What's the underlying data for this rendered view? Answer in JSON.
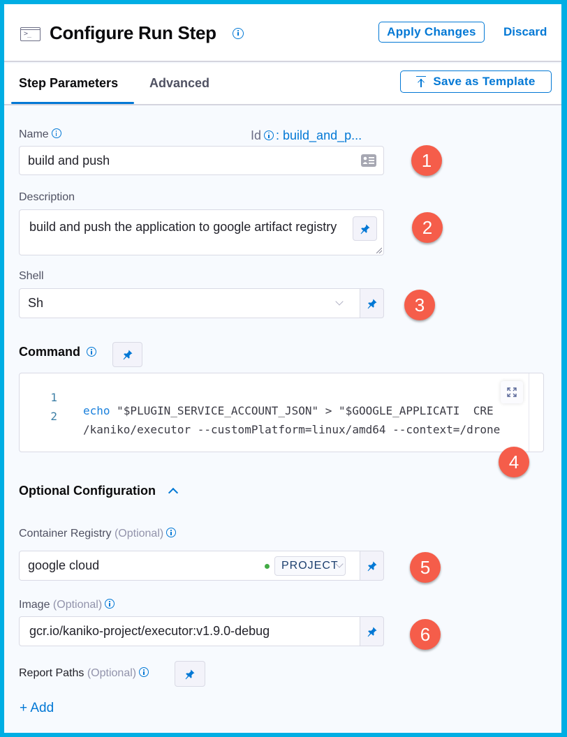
{
  "header": {
    "title": "Configure Run Step",
    "apply_label": "Apply Changes",
    "discard_label": "Discard",
    "terminal_glyph": ">_"
  },
  "tabs": {
    "items": [
      {
        "label": "Step Parameters",
        "active": true
      },
      {
        "label": "Advanced",
        "active": false
      }
    ],
    "save_template_label": "Save as Template"
  },
  "form": {
    "name": {
      "label": "Name",
      "value": "build and push",
      "id_label": "Id",
      "id_value": ": build_and_p..."
    },
    "description": {
      "label": "Description",
      "value": "build and push the application to google artifact registry"
    },
    "shell": {
      "label": "Shell",
      "value": "Sh"
    },
    "command": {
      "label": "Command",
      "lines": [
        {
          "num": "1",
          "keyword": "echo",
          "text": " \"$PLUGIN_SERVICE_ACCOUNT_JSON\" > \"$GOOGLE_APPLICATI  CRE"
        },
        {
          "num": "2",
          "keyword": "",
          "text": "/kaniko/executor --customPlatform=linux/amd64 --context=/drone"
        }
      ]
    },
    "optional_section": {
      "label": "Optional Configuration",
      "expanded": true
    },
    "container_registry": {
      "label": "Container Registry",
      "optional": "(Optional)",
      "value": "google cloud",
      "scope_tag": "PROJECT",
      "status_color": "#42ab45"
    },
    "image": {
      "label": "Image",
      "optional": "(Optional)",
      "value": "gcr.io/kaniko-project/executor:v1.9.0-debug"
    },
    "report_paths": {
      "label": "Report Paths",
      "optional": "(Optional)",
      "add_label": "+ Add"
    }
  },
  "annotations": [
    "1",
    "2",
    "3",
    "4",
    "5",
    "6"
  ],
  "colors": {
    "accent": "#0278d5",
    "badge": "#f55d4a",
    "frame": "#00aee4"
  }
}
